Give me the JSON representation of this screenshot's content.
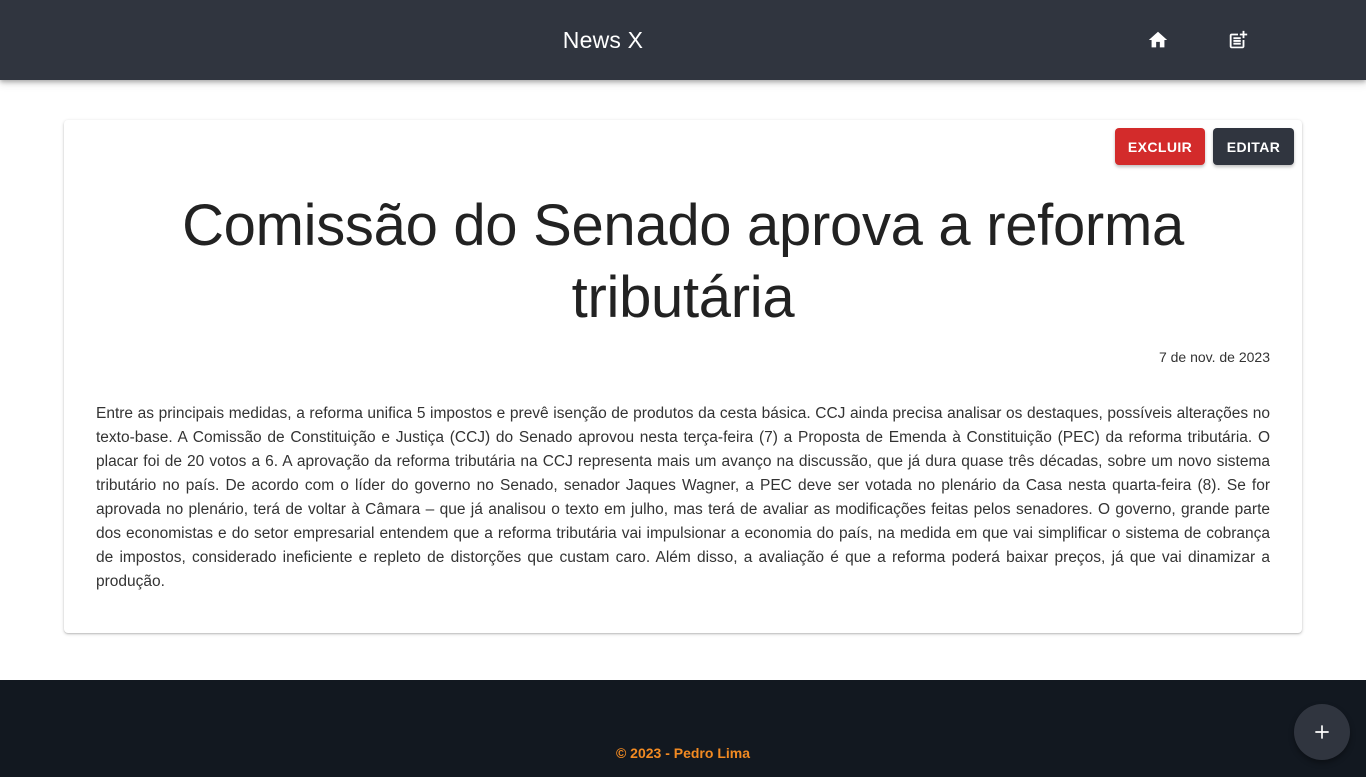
{
  "header": {
    "title": "News X",
    "nav": [
      {
        "icon": "home-icon"
      },
      {
        "icon": "post-add-icon"
      }
    ]
  },
  "article": {
    "actions": {
      "delete_label": "EXCLUIR",
      "edit_label": "EDITAR"
    },
    "title": "Comissão do Senado aprova a reforma tributária",
    "date": "7 de nov. de 2023",
    "body": "Entre as principais medidas, a reforma unifica 5 impostos e prevê isenção de produtos da cesta básica. CCJ ainda precisa analisar os destaques, possíveis alterações no texto-base. A Comissão de Constituição e Justiça (CCJ) do Senado aprovou nesta terça-feira (7) a Proposta de Emenda à Constituição (PEC) da reforma tributária. O placar foi de 20 votos a 6. A aprovação da reforma tributária na CCJ representa mais um avanço na discussão, que já dura quase três décadas, sobre um novo sistema tributário no país. De acordo com o líder do governo no Senado, senador Jaques Wagner, a PEC deve ser votada no plenário da Casa nesta quarta-feira (8). Se for aprovada no plenário, terá de voltar à Câmara – que já analisou o texto em julho, mas terá de avaliar as modificações feitas pelos senadores. O governo, grande parte dos economistas e do setor empresarial entendem que a reforma tributária vai impulsionar a economia do país, na medida em que vai simplificar o sistema de cobrança de impostos, considerado ineficiente e repleto de distorções que custam caro. Além disso, a avaliação é que a reforma poderá baixar preços, já que vai dinamizar a produção."
  },
  "footer": {
    "text": "© 2023 - Pedro Lima"
  },
  "fab": {
    "icon": "plus-icon"
  },
  "colors": {
    "header_bg": "#30353f",
    "delete_button": "#d32b2b",
    "edit_button": "#30353f",
    "footer_bg": "#121820",
    "footer_text": "#f28a22"
  }
}
